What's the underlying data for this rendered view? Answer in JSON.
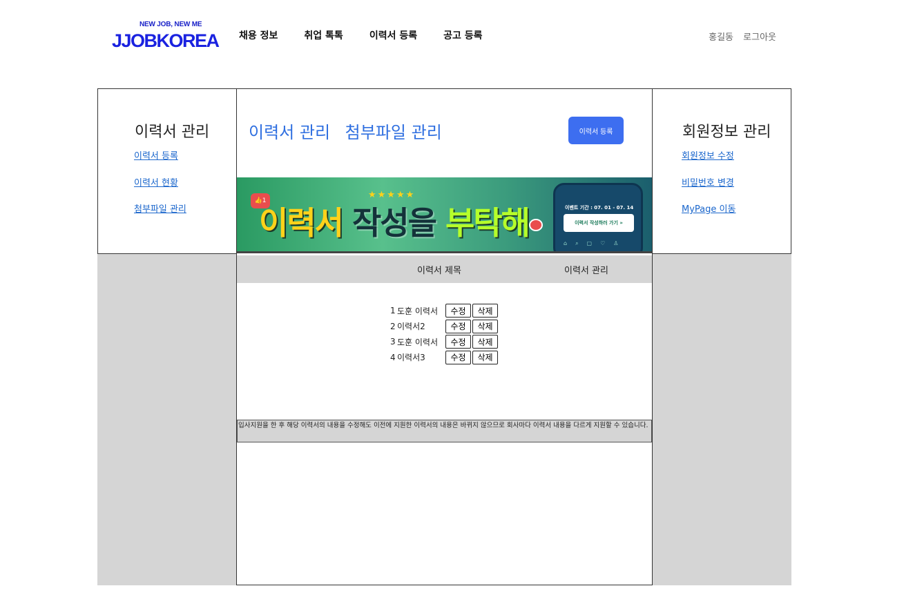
{
  "header": {
    "logo_tagline": "NEW JOB, NEW ME",
    "logo_text": "JJOBKOREA",
    "nav": [
      "채용 정보",
      "취업 톡톡",
      "이력서 등록",
      "공고 등록"
    ],
    "user_name": "홍길동",
    "logout": "로그아웃"
  },
  "left_panel": {
    "title": "이력서 관리",
    "links": [
      "이력서 등록",
      "이력서 현황",
      "첨부파일 관리"
    ]
  },
  "right_panel": {
    "title": "회원정보 관리",
    "links": [
      "회원정보 수정",
      "비밀번호 변경",
      "MyPage 이동"
    ]
  },
  "center": {
    "tabs": [
      "이력서 관리",
      "첨부파일 관리"
    ],
    "register_button": "이력서 등록",
    "banner": {
      "badge": "1",
      "stars": "★★★★★",
      "title_part1": "이력서",
      "title_part2": "작성을",
      "title_part3": "부탁해",
      "event_period": "이벤트 기간 : 07. 01 - 07. 14",
      "cta": "이력서 작성하러 가기"
    },
    "table": {
      "headers": [
        "이력서 제목",
        "이력서 관리"
      ],
      "rows": [
        {
          "num": "1",
          "title": "도훈 이력서"
        },
        {
          "num": "2",
          "title": "이력서2"
        },
        {
          "num": "3",
          "title": "도훈 이력서"
        },
        {
          "num": "4",
          "title": "이력서3"
        }
      ],
      "edit_label": "수정",
      "delete_label": "삭제"
    },
    "notice": "입사지원을 한 후 해당 이력서의 내용을 수정해도 이전에 지원한 이력서의 내용은 바뀌지 않으므로 회사마다 이력서 내용을 다르게 지원할 수 있습니다."
  }
}
